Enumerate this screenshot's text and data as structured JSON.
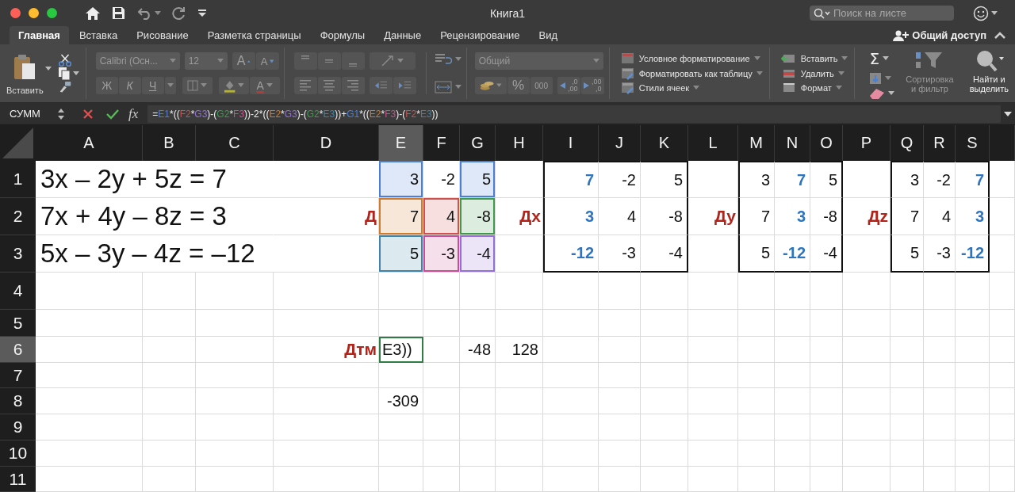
{
  "window": {
    "title": "Книга1",
    "search": {
      "placeholder": "Поиск на листе"
    }
  },
  "tabs": [
    {
      "label": "Главная",
      "selected": true
    },
    {
      "label": "Вставка",
      "selected": false
    },
    {
      "label": "Рисование",
      "selected": false
    },
    {
      "label": "Разметка страницы",
      "selected": false
    },
    {
      "label": "Формулы",
      "selected": false
    },
    {
      "label": "Данные",
      "selected": false
    },
    {
      "label": "Рецензирование",
      "selected": false
    },
    {
      "label": "Вид",
      "selected": false
    }
  ],
  "share": {
    "label": "Общий доступ"
  },
  "ribbon": {
    "clipboard": {
      "paste_label": "Вставить"
    },
    "font": {
      "disabled": true,
      "font_name": "Calibri (Осн...",
      "font_size": "12",
      "grow": "A",
      "shrink": "A",
      "styles": [
        "Ж",
        "К",
        "Ч"
      ],
      "font_color": "A"
    },
    "alignment": {
      "disabled": true
    },
    "number": {
      "disabled": true,
      "format": "Общий",
      "percent": "%",
      "thousands": "000",
      "decimals": [
        {
          "top": ",0",
          "bottom": ",00"
        },
        {
          "top": ",00",
          "bottom": ",0"
        }
      ]
    },
    "styles": [
      "Условное форматирование",
      "Форматировать как таблицу",
      "Стили ячеек"
    ],
    "cells": [
      "Вставить",
      "Удалить",
      "Формат"
    ],
    "editing": {
      "sum": "Σ",
      "sort": {
        "label": "Сортировка и фильтр",
        "disabled": true
      },
      "find": {
        "label": "Найти и выделить",
        "disabled": false
      }
    }
  },
  "formula_bar": {
    "name_box": "СУММ",
    "fx": "fx",
    "formula": [
      {
        "text": "="
      },
      {
        "text": "E1",
        "color": "#4a7fd6"
      },
      {
        "text": "*(("
      },
      {
        "text": "F2",
        "color": "#d0504d"
      },
      {
        "text": "*"
      },
      {
        "text": "G3",
        "color": "#9370d8"
      },
      {
        "text": ")-("
      },
      {
        "text": "G2",
        "color": "#3f9a4c"
      },
      {
        "text": "*"
      },
      {
        "text": "F3",
        "color": "#c84d92"
      },
      {
        "text": "))-2*(("
      },
      {
        "text": "E2",
        "color": "#d07a2e"
      },
      {
        "text": "*"
      },
      {
        "text": "G3",
        "color": "#9370d8"
      },
      {
        "text": ")-("
      },
      {
        "text": "G2",
        "color": "#3f9a4c"
      },
      {
        "text": "*"
      },
      {
        "text": "E3",
        "color": "#3f84a8"
      },
      {
        "text": "))+"
      },
      {
        "text": "G1",
        "color": "#4a7fd6"
      },
      {
        "text": "*(("
      },
      {
        "text": "E2",
        "color": "#d07a2e"
      },
      {
        "text": "*"
      },
      {
        "text": "F3",
        "color": "#c84d92"
      },
      {
        "text": ")-("
      },
      {
        "text": "F2",
        "color": "#d0504d"
      },
      {
        "text": "*"
      },
      {
        "text": "E3",
        "color": "#3f84a8"
      },
      {
        "text": "))"
      }
    ]
  },
  "sheet": {
    "columns": [
      {
        "label": "A",
        "selected": false
      },
      {
        "label": "B",
        "selected": false
      },
      {
        "label": "C",
        "selected": false
      },
      {
        "label": "D",
        "selected": false
      },
      {
        "label": "E",
        "selected": true
      },
      {
        "label": "F",
        "selected": false
      },
      {
        "label": "G",
        "selected": false
      },
      {
        "label": "H",
        "selected": false
      },
      {
        "label": "I",
        "selected": false
      },
      {
        "label": "J",
        "selected": false
      },
      {
        "label": "K",
        "selected": false
      },
      {
        "label": "L",
        "selected": false
      },
      {
        "label": "M",
        "selected": false
      },
      {
        "label": "N",
        "selected": false
      },
      {
        "label": "O",
        "selected": false
      },
      {
        "label": "P",
        "selected": false
      },
      {
        "label": "Q",
        "selected": false
      },
      {
        "label": "R",
        "selected": false
      },
      {
        "label": "S",
        "selected": false
      }
    ],
    "rows": [
      {
        "header": "1",
        "selected": false,
        "cells": [
          {
            "text": "3x – 2y + 5z = 7",
            "kind": "label",
            "selected": false
          },
          null,
          null,
          null,
          {
            "text": "3",
            "kind": "number",
            "selected": false,
            "color": "#4a7fd6"
          },
          {
            "text": "-2",
            "kind": "number",
            "selected": false
          },
          {
            "text": "5",
            "kind": "number",
            "selected": false,
            "color": "#4a7fd6"
          },
          null,
          {
            "text": "7",
            "kind": "accent",
            "selected": false,
            "border": {
              "left": true,
              "top": true
            }
          },
          {
            "text": "-2",
            "kind": "number",
            "selected": false,
            "border": {
              "top": true
            }
          },
          {
            "text": "5",
            "kind": "number",
            "selected": false,
            "border": {
              "top": true,
              "right": true
            }
          },
          null,
          {
            "text": "3",
            "kind": "number",
            "selected": false,
            "border": {
              "left": true,
              "top": true
            }
          },
          {
            "text": "7",
            "kind": "accent",
            "selected": false,
            "border": {
              "top": true
            }
          },
          {
            "text": "5",
            "kind": "number",
            "selected": false,
            "border": {
              "top": true,
              "right": true
            }
          },
          null,
          {
            "text": "3",
            "kind": "number",
            "selected": false,
            "border": {
              "left": true,
              "top": true
            }
          },
          {
            "text": "-2",
            "kind": "number",
            "selected": false,
            "border": {
              "top": true
            }
          },
          {
            "text": "7",
            "kind": "accent",
            "selected": false,
            "border": {
              "top": true,
              "right": true
            }
          }
        ]
      },
      {
        "header": "2",
        "selected": false,
        "cells": [
          {
            "text": "7x + 4y – 8z = 3",
            "kind": "label",
            "selected": false
          },
          null,
          null,
          {
            "text": "Д",
            "kind": "caption",
            "selected": false
          },
          {
            "text": "7",
            "kind": "number",
            "selected": false,
            "color": "#d07a2e"
          },
          {
            "text": "4",
            "kind": "number",
            "selected": false,
            "color": "#d0504d"
          },
          {
            "text": "-8",
            "kind": "number",
            "selected": false,
            "color": "#3f9a4c"
          },
          {
            "text": "Дх",
            "kind": "caption",
            "selected": false
          },
          {
            "text": "3",
            "kind": "accent",
            "selected": false,
            "border": {
              "left": true
            }
          },
          {
            "text": "4",
            "kind": "number",
            "selected": false
          },
          {
            "text": "-8",
            "kind": "number",
            "selected": false,
            "border": {
              "right": true
            }
          },
          {
            "text": "Ду",
            "kind": "caption",
            "selected": false
          },
          {
            "text": "7",
            "kind": "number",
            "selected": false,
            "border": {
              "left": true
            }
          },
          {
            "text": "3",
            "kind": "accent",
            "selected": false
          },
          {
            "text": "-8",
            "kind": "number",
            "selected": false,
            "border": {
              "right": true
            }
          },
          {
            "text": "Дz",
            "kind": "caption",
            "selected": false
          },
          {
            "text": "7",
            "kind": "number",
            "selected": false,
            "border": {
              "left": true
            }
          },
          {
            "text": "4",
            "kind": "number",
            "selected": false
          },
          {
            "text": "3",
            "kind": "accent",
            "selected": false,
            "border": {
              "right": true
            }
          }
        ]
      },
      {
        "header": "3",
        "selected": false,
        "cells": [
          {
            "text": "5x – 3y – 4z = –12",
            "kind": "label",
            "selected": false
          },
          null,
          null,
          null,
          {
            "text": "5",
            "kind": "number",
            "selected": false,
            "color": "#3f84a8"
          },
          {
            "text": "-3",
            "kind": "number",
            "selected": false,
            "color": "#c84d92"
          },
          {
            "text": "-4",
            "kind": "number",
            "selected": false,
            "color": "#9370d8"
          },
          null,
          {
            "text": "-12",
            "kind": "accent",
            "selected": false,
            "border": {
              "left": true,
              "bottom": true
            }
          },
          {
            "text": "-3",
            "kind": "number",
            "selected": false,
            "border": {
              "bottom": true
            }
          },
          {
            "text": "-4",
            "kind": "number",
            "selected": false,
            "border": {
              "right": true,
              "bottom": true
            }
          },
          null,
          {
            "text": "5",
            "kind": "number",
            "selected": false,
            "border": {
              "left": true,
              "bottom": true
            }
          },
          {
            "text": "-12",
            "kind": "accent",
            "selected": false,
            "border": {
              "bottom": true
            }
          },
          {
            "text": "-4",
            "kind": "number",
            "selected": false,
            "border": {
              "right": true,
              "bottom": true
            }
          },
          null,
          {
            "text": "5",
            "kind": "number",
            "selected": false,
            "border": {
              "left": true,
              "bottom": true
            }
          },
          {
            "text": "-3",
            "kind": "number",
            "selected": false,
            "border": {
              "bottom": true
            }
          },
          {
            "text": "-12",
            "kind": "accent",
            "selected": false,
            "border": {
              "right": true,
              "bottom": true
            }
          }
        ]
      },
      {
        "header": "4",
        "selected": false
      },
      {
        "header": "5",
        "selected": false
      },
      {
        "header": "6",
        "selected": true,
        "cells": [
          null,
          null,
          null,
          {
            "text": "Дтм",
            "kind": "caption",
            "selected": false
          },
          {
            "text": "E3))",
            "kind": "text",
            "selected": true
          },
          null,
          {
            "text": "-48",
            "kind": "number",
            "selected": false
          },
          {
            "text": "128",
            "kind": "number",
            "selected": false
          }
        ]
      },
      {
        "header": "7",
        "selected": false
      },
      {
        "header": "8",
        "selected": false,
        "cells": [
          null,
          null,
          null,
          null,
          {
            "text": "-309",
            "kind": "number",
            "selected": false
          }
        ]
      },
      {
        "header": "9",
        "selected": false
      },
      {
        "header": "10",
        "selected": false
      },
      {
        "header": "11",
        "selected": false
      }
    ]
  }
}
